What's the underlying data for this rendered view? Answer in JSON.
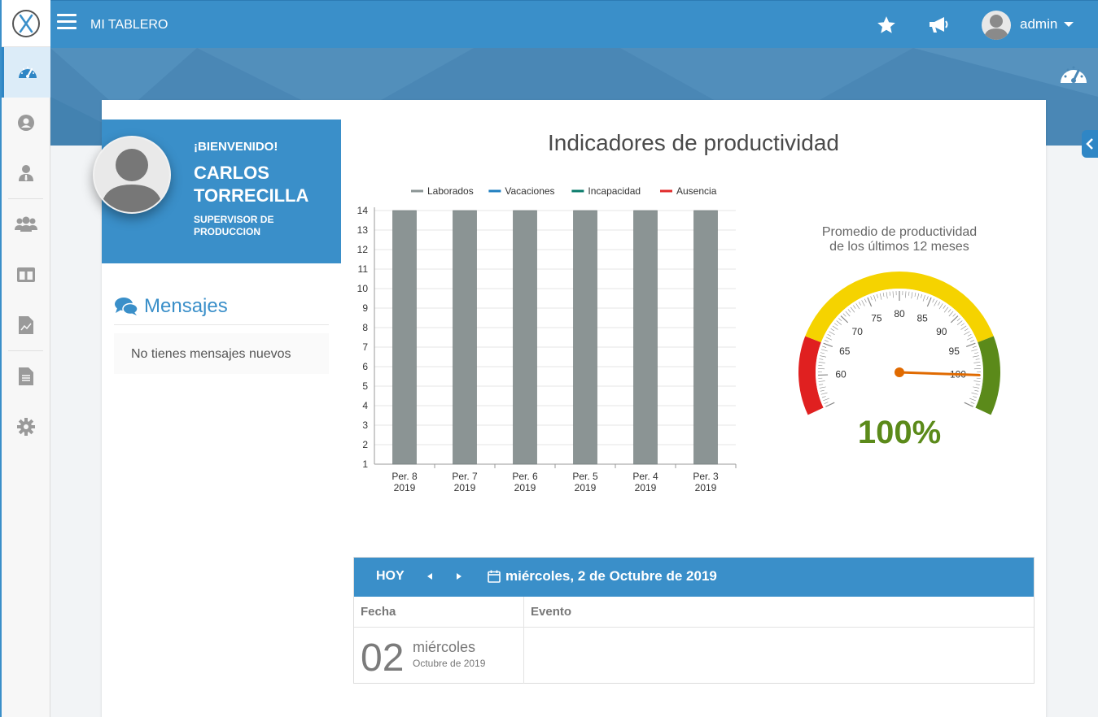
{
  "app": {
    "page_title": "MI TABLERO",
    "user_name": "admin"
  },
  "welcome": {
    "greeting": "¡BIENVENIDO!",
    "name": "CARLOS TORRECILLA",
    "role": "SUPERVISOR DE PRODUCCION"
  },
  "messages": {
    "title": "Mensajes",
    "empty_text": "No tienes mensajes nuevos"
  },
  "dashboard": {
    "title": "Indicadores de productividad"
  },
  "chart_data": {
    "type": "bar",
    "categories": [
      [
        "Per. 8",
        "2019"
      ],
      [
        "Per. 7",
        "2019"
      ],
      [
        "Per. 6",
        "2019"
      ],
      [
        "Per. 5",
        "2019"
      ],
      [
        "Per. 4",
        "2019"
      ],
      [
        "Per. 3",
        "2019"
      ]
    ],
    "series": [
      {
        "name": "Laborados",
        "color": "#8b9494",
        "values": [
          14,
          14,
          14,
          14,
          14,
          14
        ]
      },
      {
        "name": "Vacaciones",
        "color": "#1f7fc0",
        "values": [
          0,
          0,
          0,
          0,
          0,
          0
        ]
      },
      {
        "name": "Incapacidad",
        "color": "#0a7b6b",
        "values": [
          0,
          0,
          0,
          0,
          0,
          0
        ]
      },
      {
        "name": "Ausencia",
        "color": "#e12b2b",
        "values": [
          0,
          0,
          0,
          0,
          0,
          0
        ]
      }
    ],
    "ylim": [
      1,
      14
    ],
    "yticks": [
      1,
      2,
      3,
      4,
      5,
      6,
      7,
      8,
      9,
      10,
      11,
      12,
      13,
      14
    ],
    "legend": "top"
  },
  "gauge": {
    "title_line1": "Promedio de productividad",
    "title_line2": "de los últimos 12 meses",
    "value": 100,
    "display": "100%",
    "min": 55,
    "max": 105,
    "labels": [
      "60",
      "65",
      "70",
      "75",
      "80",
      "85",
      "90",
      "95",
      "100"
    ],
    "bands": [
      {
        "from": 55,
        "to": 65,
        "color": "#e02020"
      },
      {
        "from": 65,
        "to": 95,
        "color": "#f5d300"
      },
      {
        "from": 95,
        "to": 105,
        "color": "#5b8a1a"
      }
    ],
    "needle_color": "#e06a00",
    "value_color": "#5b8a1a"
  },
  "calendar": {
    "today_label": "HOY",
    "current_date": "miércoles, 2 de Octubre de 2019",
    "col_fecha": "Fecha",
    "col_evento": "Evento",
    "row": {
      "day": "02",
      "weekday": "miércoles",
      "month": "Octubre de 2019",
      "event": ""
    }
  },
  "icons": [
    "logo-x-icon",
    "dashboard-icon",
    "user-circle-icon",
    "user-tie-icon",
    "users-icon",
    "columns-icon",
    "chart-file-icon",
    "document-icon",
    "gear-icon",
    "star-icon",
    "megaphone-icon",
    "calendar-icon",
    "comments-icon",
    "chevron-left-icon"
  ]
}
